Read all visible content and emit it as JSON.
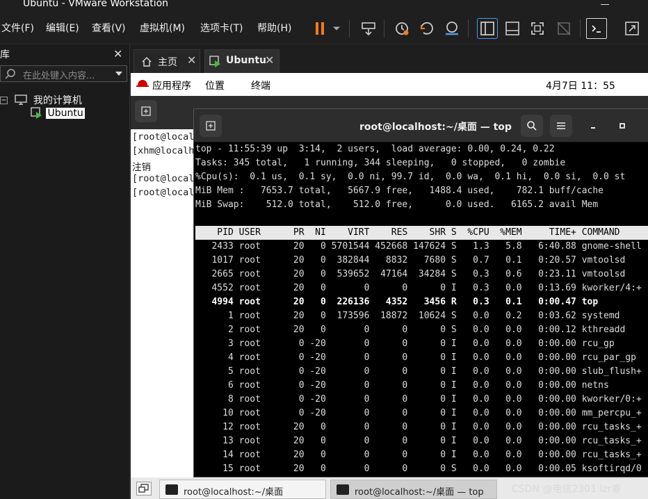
{
  "window": {
    "title": "Ubuntu - VMware Workstation"
  },
  "menu": [
    "文件(F)",
    "编辑(E)",
    "查看(V)",
    "虚拟机(M)",
    "选项卡(T)",
    "帮助(H)"
  ],
  "sidebar": {
    "header": "库",
    "search_placeholder": "在此处键入内容...",
    "tree": [
      {
        "label": "我的计算机"
      },
      {
        "label": "Ubuntu"
      }
    ]
  },
  "tabs": [
    {
      "label": "主页"
    },
    {
      "label": "Ubuntu"
    }
  ],
  "gnome": {
    "apps": "应用程序",
    "places": "位置",
    "terminal": "终端",
    "clock": "4月7日  11：55"
  },
  "bg_terminal": {
    "lines": [
      "[root@local",
      "[xhm@localh",
      "注销",
      "[root@local",
      "[root@local"
    ]
  },
  "top_window": {
    "title": "root@localhost:~/桌面 — top",
    "summary": [
      "top - 11:55:39 up  3:14,  2 users,  load average: 0.00, 0.24, 0.22",
      "Tasks: 345 total,   1 running, 344 sleeping,   0 stopped,   0 zombie",
      "%Cpu(s):  0.1 us,  0.1 sy,  0.0 ni, 99.7 id,  0.0 wa,  0.1 hi,  0.0 si,  0.0 st",
      "MiB Mem :   7653.7 total,   5667.9 free,   1488.4 used,    782.1 buff/cache",
      "MiB Swap:    512.0 total,    512.0 free,      0.0 used.   6165.2 avail Mem"
    ],
    "header": "    PID USER      PR  NI    VIRT    RES    SHR S  %CPU  %MEM     TIME+ COMMAND",
    "rows": [
      "   2433 root      20   0 5701544 452668 147624 S   1.3   5.8   6:40.88 gnome-shell",
      "   1017 root      20   0  382844   8832   7680 S   0.7   0.1   0:20.57 vmtoolsd",
      "   2665 root      20   0  539652  47164  34284 S   0.3   0.6   0:23.11 vmtoolsd",
      "   4552 root      20   0       0      0      0 I   0.3   0.0   0:13.69 kworker/4:+",
      "   4994 root      20   0  226136   4352   3456 R   0.3   0.1   0:00.47 top",
      "      1 root      20   0  173596  18872  10624 S   0.0   0.2   0:03.62 systemd",
      "      2 root      20   0       0      0      0 S   0.0   0.0   0:00.12 kthreadd",
      "      3 root       0 -20       0      0      0 I   0.0   0.0   0:00.00 rcu_gp",
      "      4 root       0 -20       0      0      0 I   0.0   0.0   0:00.00 rcu_par_gp",
      "      5 root       0 -20       0      0      0 I   0.0   0.0   0:00.00 slub_flush+",
      "      6 root       0 -20       0      0      0 I   0.0   0.0   0:00.00 netns",
      "      8 root       0 -20       0      0      0 I   0.0   0.0   0:00.00 kworker/0:+",
      "     10 root       0 -20       0      0      0 I   0.0   0.0   0:00.00 mm_percpu_+",
      "     12 root      20   0       0      0      0 I   0.0   0.0   0:00.00 rcu_tasks_+",
      "     13 root      20   0       0      0      0 I   0.0   0.0   0:00.00 rcu_tasks_+",
      "     14 root      20   0       0      0      0 I   0.0   0.0   0:00.00 rcu_tasks_+",
      "     15 root      20   0       0      0      0 S   0.0   0.0   0:00.05 ksoftirqd/0"
    ]
  },
  "taskbar": [
    {
      "label": "root@localhost:~/桌面"
    },
    {
      "label": "root@localhost:~/桌面 — top"
    }
  ],
  "watermark": "CSDN @电信2301  lzr睿",
  "colors": {
    "accent_orange": "#f07c1f",
    "accent_blue": "#4a9be8"
  }
}
